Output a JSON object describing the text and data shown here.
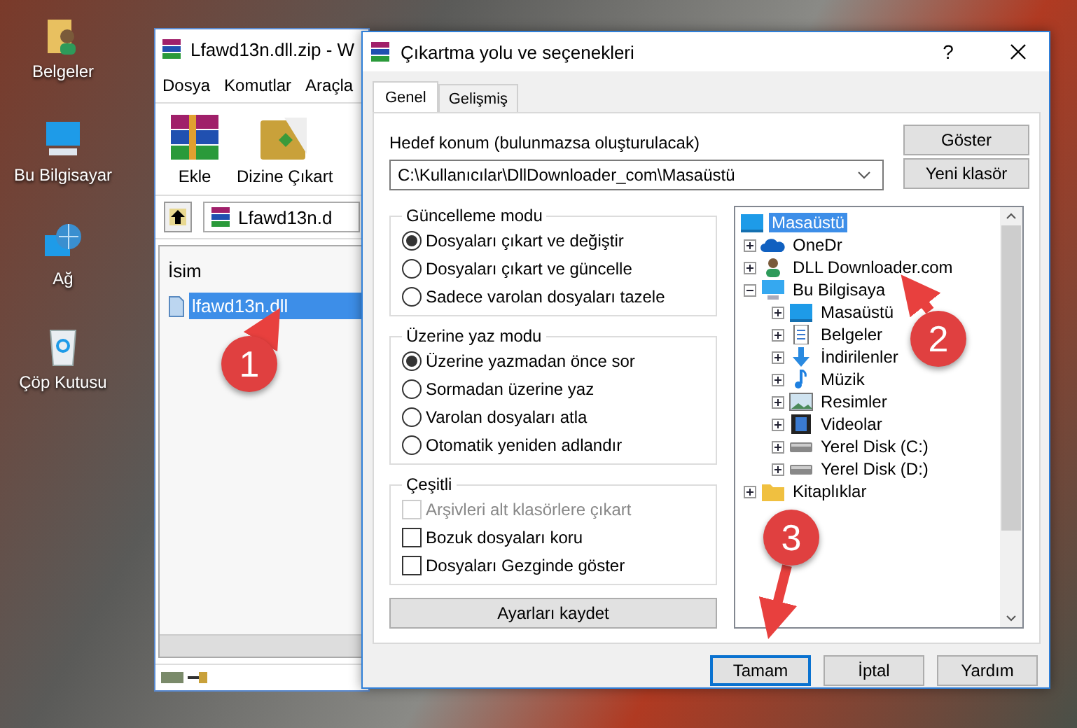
{
  "desktop_icons": [
    {
      "label": "Belgeler",
      "kind": "documents"
    },
    {
      "label": "Bu Bilgisayar",
      "kind": "computer"
    },
    {
      "label": "Ağ",
      "kind": "network"
    },
    {
      "label": "Çöp Kutusu",
      "kind": "recycle"
    }
  ],
  "archive_window": {
    "title": "Lfawd13n.dll.zip - W",
    "menu": [
      "Dosya",
      "Komutlar",
      "Araçla"
    ],
    "toolbar": [
      {
        "label": "Ekle",
        "kind": "add"
      },
      {
        "label": "Dizine Çıkart",
        "kind": "extract"
      }
    ],
    "address": "Lfawd13n.d",
    "column": "İsim",
    "files": [
      {
        "name": "lfawd13n.dll",
        "selected": true
      }
    ]
  },
  "dialog": {
    "title": "Çıkartma yolu ve seçenekleri",
    "help": "?",
    "tabs": [
      {
        "label": "Genel",
        "selected": true
      },
      {
        "label": "Gelişmiş",
        "selected": false
      }
    ],
    "destination_label": "Hedef konum (bulunmazsa oluşturulacak)",
    "destination": "C:\\Kullanıcılar\\DllDownloader_com\\Masaüstü",
    "side_buttons": [
      "Göster",
      "Yeni klasör"
    ],
    "groups": [
      {
        "title": "Güncelleme modu",
        "options": [
          {
            "kind": "radio",
            "label": "Dosyaları çıkart ve değiştir",
            "selected": true
          },
          {
            "kind": "radio",
            "label": "Dosyaları çıkart ve güncelle",
            "selected": false
          },
          {
            "kind": "radio",
            "label": "Sadece varolan dosyaları tazele",
            "selected": false
          }
        ]
      },
      {
        "title": "Üzerine yaz modu",
        "options": [
          {
            "kind": "radio",
            "label": "Üzerine yazmadan önce sor",
            "selected": true
          },
          {
            "kind": "radio",
            "label": "Sormadan üzerine yaz",
            "selected": false
          },
          {
            "kind": "radio",
            "label": "Varolan dosyaları atla",
            "selected": false
          },
          {
            "kind": "radio",
            "label": "Otomatik yeniden adlandır",
            "selected": false
          }
        ]
      },
      {
        "title": "Çeşitli",
        "options": [
          {
            "kind": "checkbox",
            "label": "Arşivleri alt klasörlere çıkart",
            "checked": false,
            "disabled": true
          },
          {
            "kind": "checkbox",
            "label": "Bozuk dosyaları koru",
            "checked": false,
            "disabled": false
          },
          {
            "kind": "checkbox",
            "label": "Dosyaları Gezginde göster",
            "checked": false,
            "disabled": false
          }
        ]
      }
    ],
    "save_button": "Ayarları kaydet",
    "tree": [
      {
        "label": "Masaüstü",
        "kind": "desktop",
        "selected": true,
        "children": [
          {
            "label": "OneDr",
            "kind": "cloud",
            "selected": false,
            "expanded": false
          },
          {
            "label": "DLL Downloader.com",
            "kind": "user",
            "selected": false,
            "expanded": false
          },
          {
            "label": "Bu Bilgisaya",
            "kind": "computer",
            "selected": false,
            "expanded": true,
            "children": [
              {
                "label": "Masaüstü",
                "kind": "desktop",
                "selected": false,
                "expanded": false
              },
              {
                "label": "Belgeler",
                "kind": "document",
                "selected": false,
                "expanded": false
              },
              {
                "label": "İndirilenler",
                "kind": "download",
                "selected": false,
                "expanded": false
              },
              {
                "label": "Müzik",
                "kind": "music",
                "selected": false,
                "expanded": false
              },
              {
                "label": "Resimler",
                "kind": "picture",
                "selected": false,
                "expanded": false
              },
              {
                "label": "Videolar",
                "kind": "film",
                "selected": false,
                "expanded": false
              },
              {
                "label": "Yerel Disk (C:)",
                "kind": "disk",
                "selected": false,
                "expanded": false
              },
              {
                "label": "Yerel Disk (D:)",
                "kind": "disk",
                "selected": false,
                "expanded": false
              }
            ]
          },
          {
            "label": "Kitaplıklar",
            "kind": "folder",
            "selected": false,
            "expanded": false
          }
        ]
      }
    ],
    "buttons": [
      {
        "label": "Tamam",
        "default": true
      },
      {
        "label": "İptal",
        "default": false
      },
      {
        "label": "Yardım",
        "default": false
      }
    ]
  },
  "annotations": [
    {
      "label": "1"
    },
    {
      "label": "2"
    },
    {
      "label": "3"
    }
  ]
}
